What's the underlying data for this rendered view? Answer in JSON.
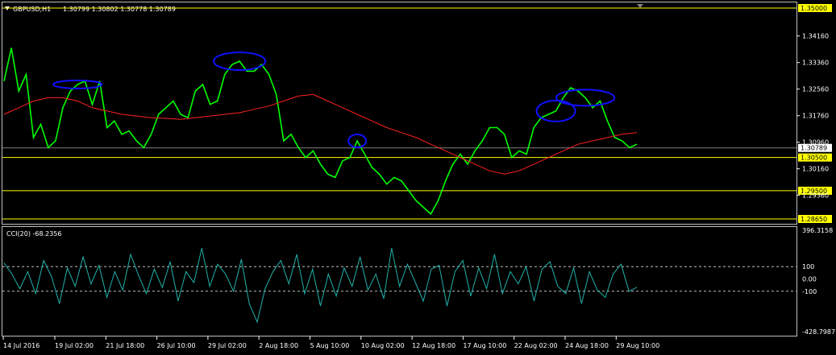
{
  "header": {
    "symbol": "GBPUSD,H1",
    "ohlc": "1.30799 1.30802 1.30778 1.30789",
    "cci_label": "CCI(20) -68.2356"
  },
  "colors": {
    "background": "#000000",
    "price": "#00ff00",
    "ma": "#ff2020",
    "cci": "#20b2aa",
    "level_line": "#ffff00",
    "axis_text": "#ffffff",
    "highlight_label_bg": "#ffff00",
    "ellipse": "#1010ff",
    "grid_border": "#c0c0c0"
  },
  "chart_data": [
    {
      "type": "line",
      "title": "GBPUSD,H1",
      "x": [
        "14 Jul 2016",
        "19 Jul 02:00",
        "21 Jul 18:00",
        "26 Jul 10:00",
        "29 Jul 02:00",
        "2 Aug 18:00",
        "5 Aug 10:00",
        "10 Aug 02:00",
        "12 Aug 18:00",
        "17 Aug 10:00",
        "22 Aug 02:00",
        "24 Aug 18:00",
        "29 Aug 10:00"
      ],
      "ylim": [
        1.2865,
        1.35
      ],
      "y_ticks": [
        "1.34160",
        "1.33360",
        "1.32560",
        "1.31760",
        "1.30960",
        "1.30160",
        "1.29360"
      ],
      "highlighted_levels": [
        "1.35000",
        "1.30500",
        "1.29500",
        "1.28650"
      ],
      "current_price": "1.30789",
      "series": [
        {
          "style": "price",
          "values": [
            1.328,
            1.338,
            1.325,
            1.33,
            1.311,
            1.315,
            1.308,
            1.31,
            1.32,
            1.325,
            1.327,
            1.328,
            1.321,
            1.328,
            1.314,
            1.316,
            1.312,
            1.313,
            1.31,
            1.308,
            1.312,
            1.318,
            1.32,
            1.322,
            1.318,
            1.317,
            1.325,
            1.327,
            1.321,
            1.322,
            1.33,
            1.333,
            1.334,
            1.331,
            1.331,
            1.333,
            1.33,
            1.324,
            1.31,
            1.312,
            1.308,
            1.305,
            1.307,
            1.303,
            1.3,
            1.299,
            1.304,
            1.305,
            1.31,
            1.306,
            1.302,
            1.3,
            1.297,
            1.299,
            1.298,
            1.295,
            1.292,
            1.29,
            1.288,
            1.292,
            1.298,
            1.303,
            1.306,
            1.303,
            1.307,
            1.31,
            1.314,
            1.314,
            1.312,
            1.305,
            1.307,
            1.306,
            1.314,
            1.317,
            1.318,
            1.319,
            1.323,
            1.326,
            1.325,
            1.323,
            1.32,
            1.322,
            1.316,
            1.311,
            1.31,
            1.308,
            1.309
          ]
        },
        {
          "style": "ma",
          "values": [
            1.318,
            1.32,
            1.322,
            1.323,
            1.323,
            1.322,
            1.32,
            1.319,
            1.318,
            1.3175,
            1.317,
            1.3168,
            1.3165,
            1.317,
            1.3175,
            1.318,
            1.3185,
            1.3195,
            1.3205,
            1.322,
            1.3235,
            1.324,
            1.322,
            1.32,
            1.318,
            1.316,
            1.314,
            1.3125,
            1.311,
            1.309,
            1.307,
            1.305,
            1.303,
            1.301,
            1.3,
            1.301,
            1.303,
            1.305,
            1.307,
            1.309,
            1.31,
            1.311,
            1.312,
            1.3125
          ]
        }
      ],
      "annotations": [
        "ellipse highlight markers around swing highs"
      ]
    },
    {
      "type": "line",
      "title": "CCI(20) -68.2356",
      "ylim": [
        -428.7987,
        396.3158
      ],
      "y_ticks": [
        "396.3158",
        "100",
        "0.00",
        "-100",
        "-428.7987"
      ],
      "levels": [
        100,
        -100
      ],
      "series": [
        {
          "values": [
            130,
            40,
            -80,
            60,
            -120,
            150,
            20,
            -200,
            90,
            -60,
            180,
            -40,
            110,
            -150,
            60,
            -90,
            200,
            30,
            -120,
            80,
            -70,
            140,
            -180,
            60,
            -30,
            250,
            -60,
            120,
            40,
            -100,
            160,
            -200,
            -350,
            -80,
            60,
            150,
            -40,
            200,
            -120,
            80,
            -220,
            40,
            -140,
            90,
            -60,
            180,
            -90,
            40,
            -160,
            250,
            -60,
            120,
            -30,
            -180,
            80,
            110,
            -220,
            60,
            150,
            -140,
            90,
            -80,
            200,
            -120,
            60,
            -40,
            100,
            -180,
            80,
            140,
            -60,
            -120,
            90,
            -200,
            60,
            -90,
            -150,
            40,
            120,
            -100,
            -68
          ]
        }
      ]
    }
  ]
}
